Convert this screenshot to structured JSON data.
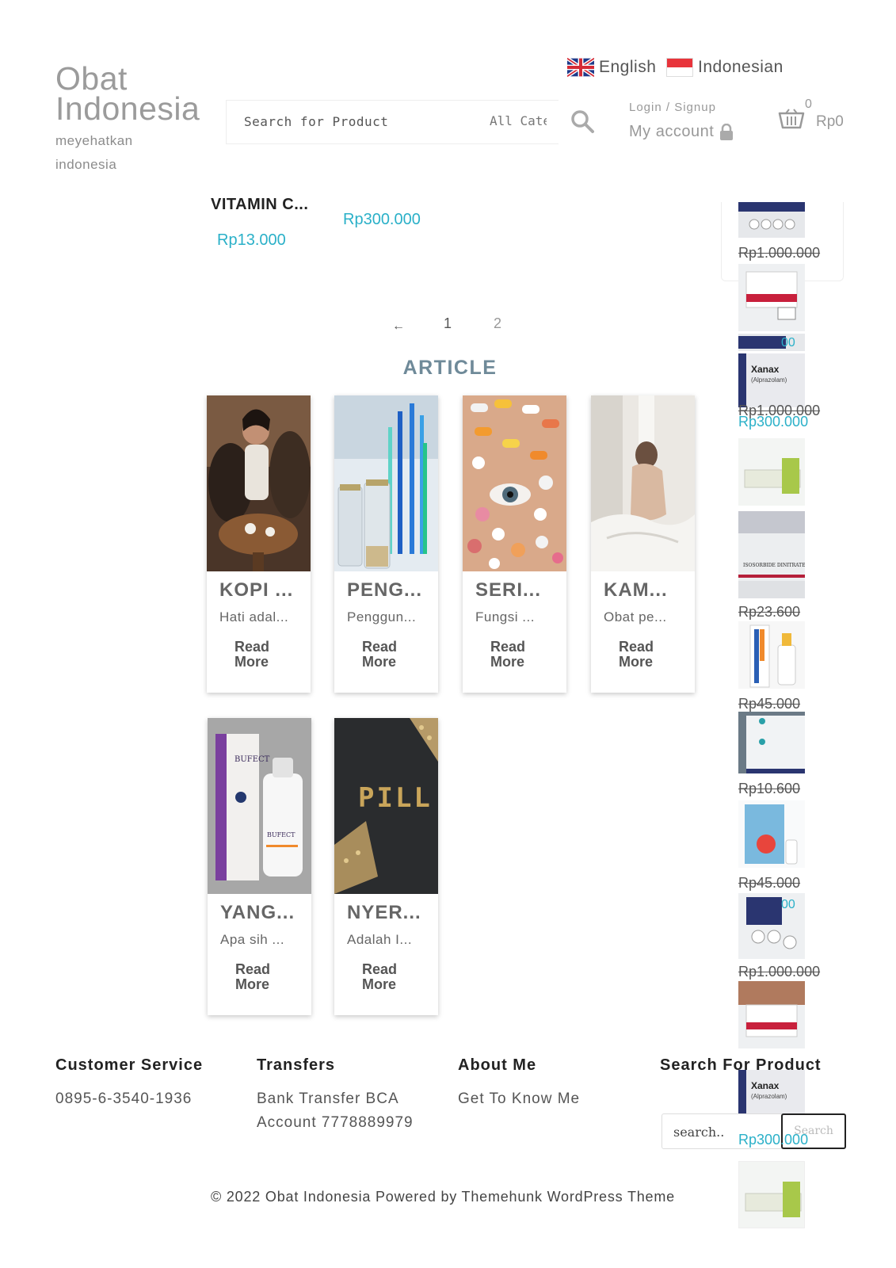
{
  "header": {
    "site_title": "Obat Indonesia",
    "tagline": "meyehatkan indonesia",
    "languages": [
      {
        "label": "English",
        "flag": "uk-flag-icon"
      },
      {
        "label": "Indonesian",
        "flag": "indonesia-flag-icon"
      }
    ],
    "search": {
      "placeholder": "Search for Product",
      "category": "All Categories"
    },
    "login_label": "Login / Signup",
    "my_account_label": "My account",
    "cart_count": "0",
    "cart_total": "Rp0"
  },
  "products": {
    "name": "VITAMIN C...",
    "price_a": "Rp13.000",
    "price_b": "Rp300.000"
  },
  "pagination": {
    "prev": "←",
    "pages": [
      "1",
      "2"
    ]
  },
  "article_heading": "ARTICLE",
  "articles": [
    {
      "title": "KOPI ...",
      "excerpt": "Hati adal...",
      "read_more": "Read More"
    },
    {
      "title": "PENG...",
      "excerpt": "Penggun...",
      "read_more": "Read More"
    },
    {
      "title": "SERI...",
      "excerpt": "Fungsi ...",
      "read_more": "Read More"
    },
    {
      "title": "KAM...",
      "excerpt": "Obat pe...",
      "read_more": "Read More"
    },
    {
      "title": "YANG...",
      "excerpt": "Apa sih ...",
      "read_more": "Read More"
    },
    {
      "title": "NYER...",
      "excerpt": "Adalah I...",
      "read_more": "Read More"
    }
  ],
  "sidebar_prices": {
    "p1": "Rp1.000.000",
    "p2": "Rp1.000.000",
    "p3": "Rp300.000",
    "p4": "Rp23.600",
    "p5": "Rp45.000",
    "p6": "Rp10.600",
    "p7": "Rp45.000",
    "p8": "Rp1.000.000",
    "p9": "Rp300.000"
  },
  "footer": {
    "customer_service": {
      "heading": "Customer Service",
      "phone": "0895-6-3540-1936"
    },
    "transfers": {
      "heading": "Transfers",
      "line1": "Bank Transfer BCA",
      "line2": "Account 7778889979"
    },
    "about": {
      "heading": "About Me",
      "link": "Get To Know Me"
    },
    "search": {
      "heading": "Search For Product",
      "placeholder": "search..",
      "button": "Search"
    },
    "copyright": "© 2022 Obat Indonesia Powered by Themehunk WordPress Theme"
  },
  "colors": {
    "accent": "#2ab0c8",
    "heading_blue": "#6f8a99"
  }
}
